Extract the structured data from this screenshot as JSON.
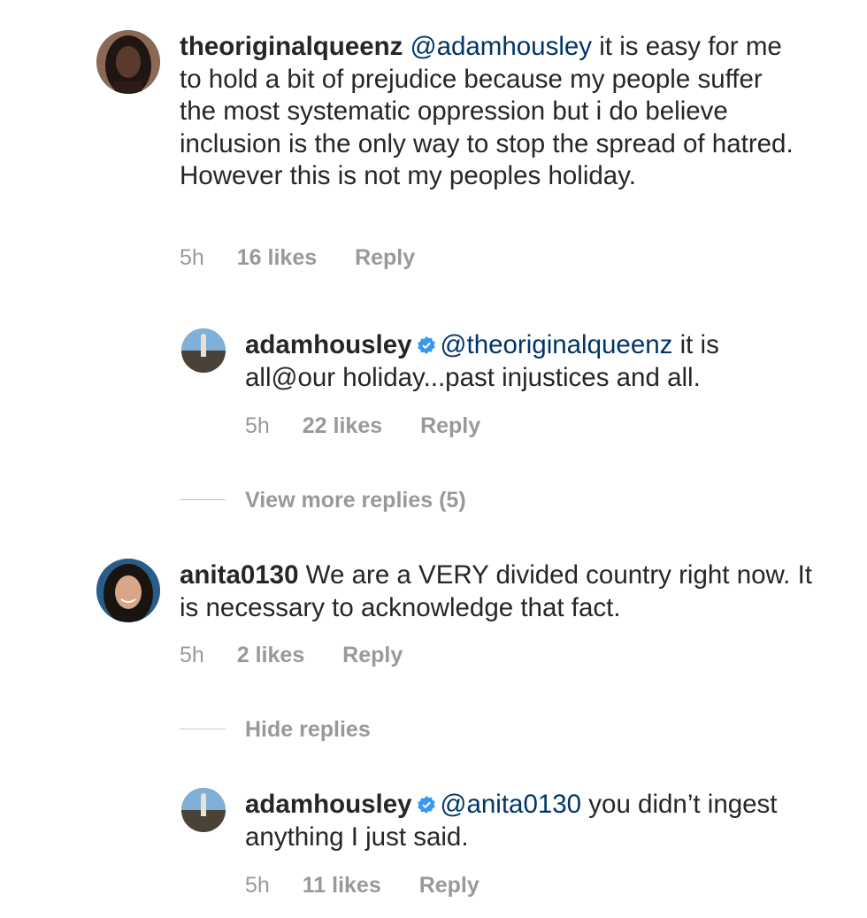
{
  "comments": [
    {
      "username": "theoriginalqueenz",
      "mention": "@adamhousley",
      "body": " it is easy for me to hold a bit of prejudice because my people suffer the most systematic oppression but i do believe inclusion is the only way to stop the spread of hatred. However this is not my peoples holiday.",
      "time": "5h",
      "likes": "16 likes",
      "reply": "Reply",
      "avatar": "avatar-theoriginalqueenz"
    },
    {
      "username": "adamhousley",
      "verified": true,
      "mention": "@theoriginalqueenz",
      "body": " it is all@our holiday...past injustices and all.",
      "time": "5h",
      "likes": "22 likes",
      "reply": "Reply",
      "avatar": "avatar-adamhousley"
    },
    {
      "username": "anita0130",
      "mention": "",
      "body": " We are a VERY divided country right now. It is necessary to acknowledge that fact.",
      "time": "5h",
      "likes": "2 likes",
      "reply": "Reply",
      "avatar": "avatar-anita0130"
    },
    {
      "username": "adamhousley",
      "verified": true,
      "mention": "@anita0130",
      "body": " you didn’t ingest anything I just said.",
      "time": "5h",
      "likes": "11 likes",
      "reply": "Reply",
      "avatar": "avatar-adamhousley"
    }
  ],
  "toggles": {
    "view_more": "View more replies (5)",
    "hide": "Hide replies"
  },
  "colors": {
    "text": "#262626",
    "mention": "#003569",
    "muted": "#999999",
    "verified": "#3897f0"
  },
  "icons": {
    "verified": "verified-badge-icon"
  }
}
